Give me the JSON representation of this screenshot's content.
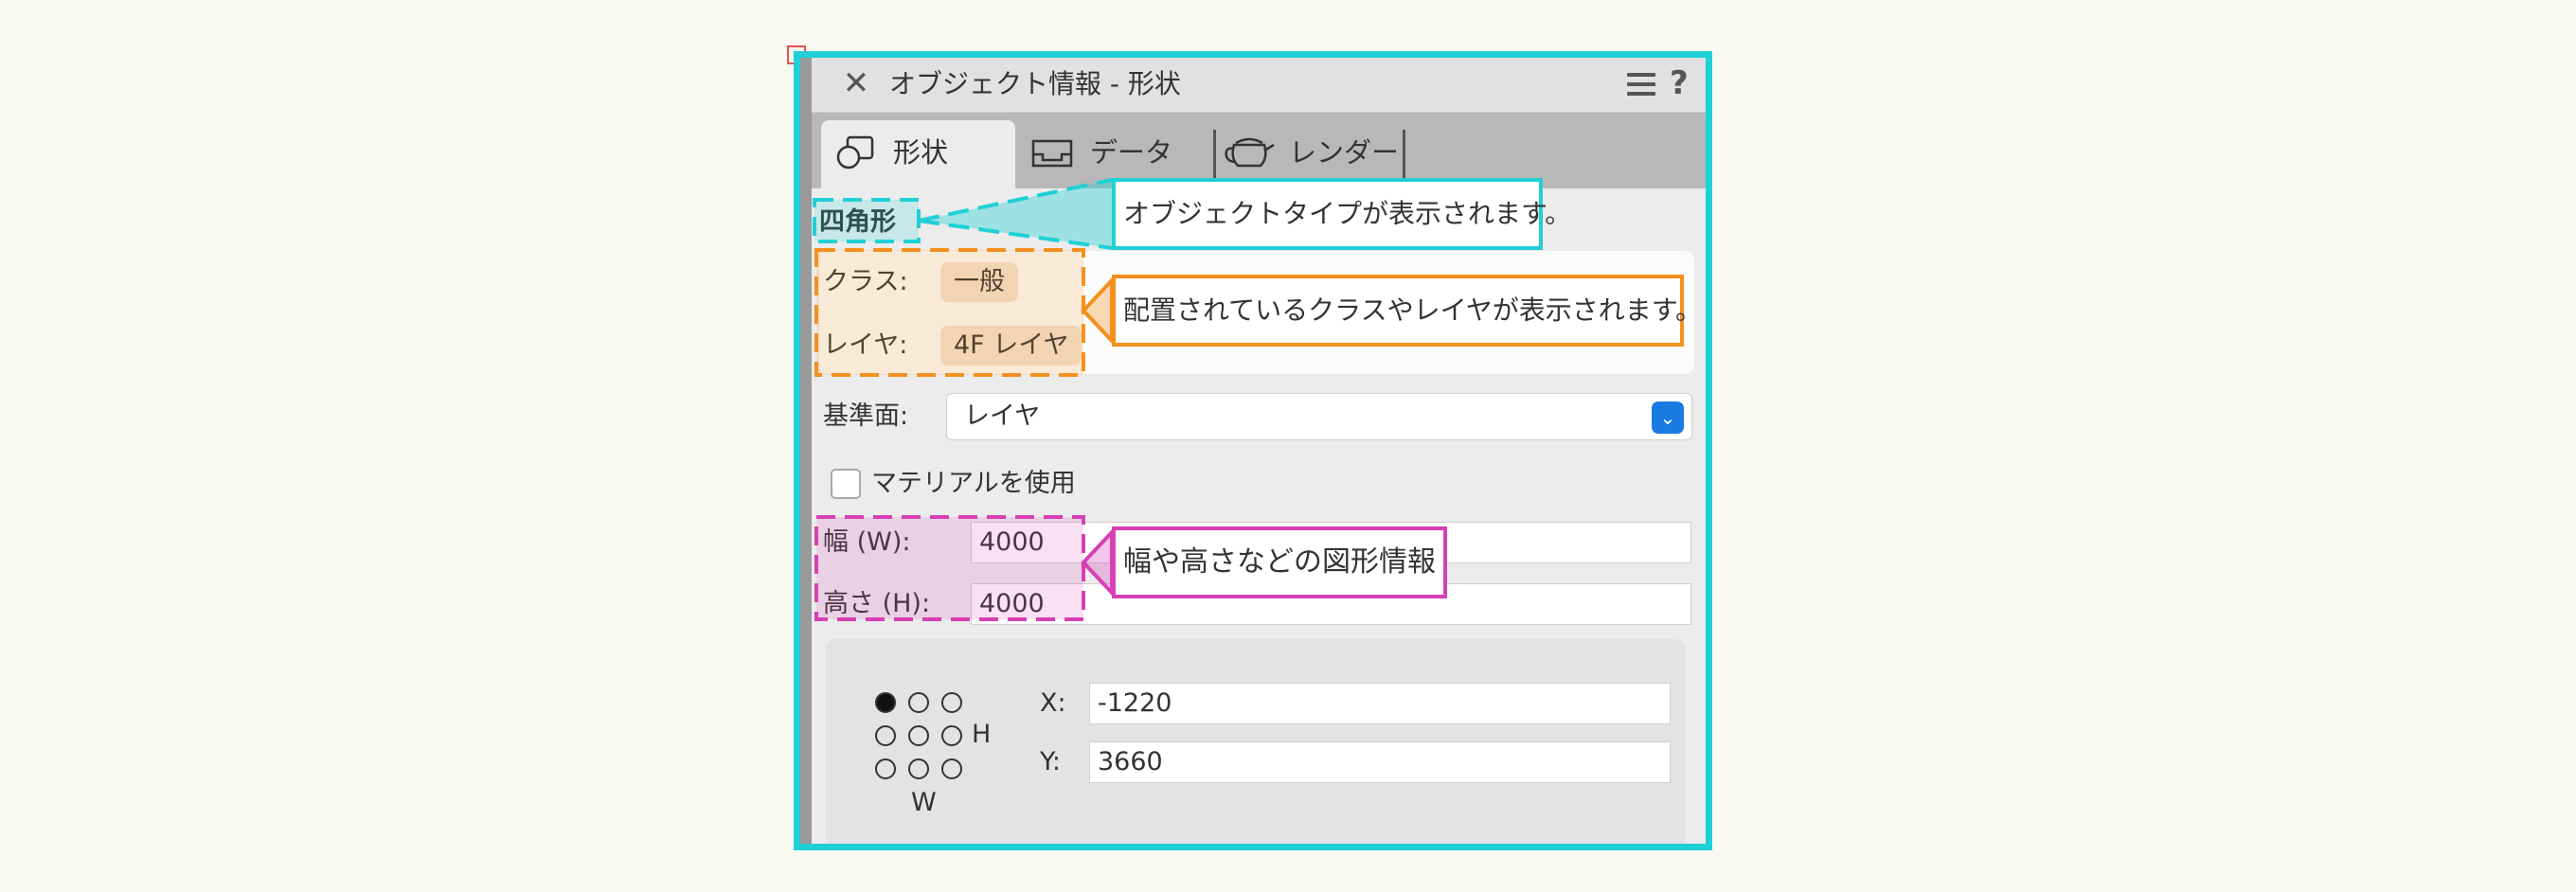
{
  "window": {
    "title": "オブジェクト情報 - 形状"
  },
  "tabs": [
    {
      "label": "形状",
      "icon": "shape-icon"
    },
    {
      "label": "データ",
      "icon": "data-tray-icon"
    },
    {
      "label": "レンダー",
      "icon": "teapot-icon"
    }
  ],
  "object_type": "四角形",
  "class_row": {
    "label": "クラス:",
    "value": "一般"
  },
  "layer_row": {
    "label": "レイヤ:",
    "value": "4F レイヤ"
  },
  "plane_row": {
    "label": "基準面:",
    "value": "レイヤ"
  },
  "material_checkbox": {
    "label": "マテリアルを使用",
    "checked": false
  },
  "width_row": {
    "label": "幅 (W):",
    "value": "4000"
  },
  "height_row": {
    "label": "高さ (H):",
    "value": "4000"
  },
  "position": {
    "x_label": "X:",
    "x_value": "-1220",
    "y_label": "Y:",
    "y_value": "3660",
    "h_label": "H",
    "w_label": "W",
    "selected_anchor": "top-left"
  },
  "annotations": {
    "object_type_note": "オブジェクトタイプが表示されます。",
    "class_layer_note": "配置されているクラスやレイヤが表示されます。",
    "geometry_note": "幅や高さなどの図形情報"
  },
  "colors": {
    "panel_border": "#1fd0d6",
    "callout_cyan": "#1fd0d6",
    "callout_orange": "#f5901e",
    "callout_pink": "#d83fb4",
    "dropdown_accent": "#1a7ae3"
  }
}
